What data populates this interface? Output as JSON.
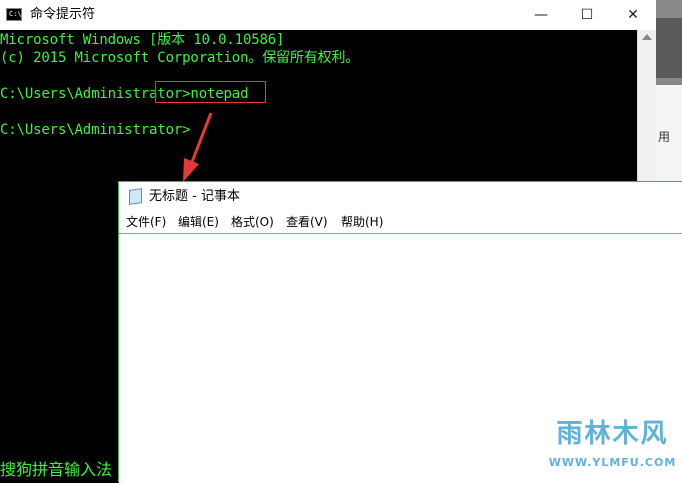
{
  "cmd": {
    "title": "命令提示符",
    "icon_text": "C:\\",
    "lines": [
      "Microsoft Windows [版本 10.0.10586]",
      "(c) 2015 Microsoft Corporation。保留所有权利。",
      "C:\\Users\\Administrator>notepad",
      "C:\\Users\\Administrator>"
    ],
    "ime_status": "搜狗拼音输入法",
    "controls": {
      "minimize": "—",
      "maximize": "☐",
      "close": "✕"
    },
    "text_color": "#3df13d"
  },
  "notepad": {
    "title": "无标题 - 记事本",
    "menu": [
      "文件(F)",
      "编辑(E)",
      "格式(O)",
      "查看(V)",
      "帮助(H)"
    ]
  },
  "background": {
    "partial_text": "用"
  },
  "annotation": {
    "highlight_color": "#e53935"
  },
  "watermark": {
    "name": "雨林木风",
    "url": "WWW.YLMFU.COM"
  }
}
